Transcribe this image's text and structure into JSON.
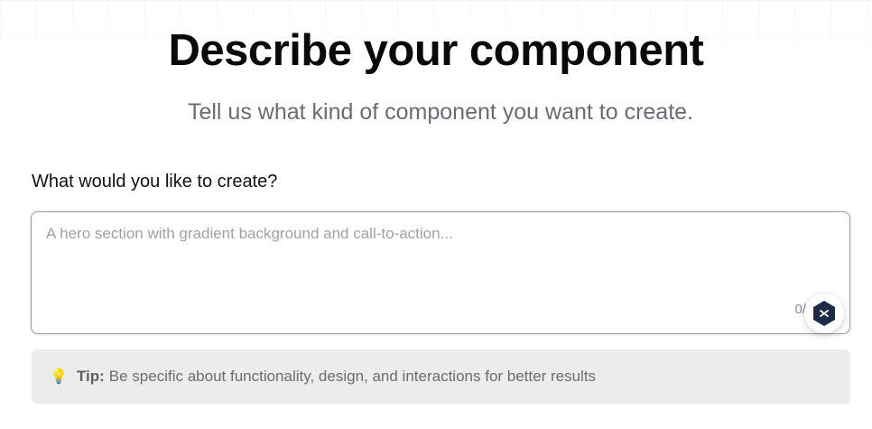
{
  "header": {
    "title": "Describe your component",
    "subtitle": "Tell us what kind of component you want to create."
  },
  "form": {
    "label": "What would you like to create?",
    "placeholder": "A hero section with gradient background and call-to-action...",
    "value": "",
    "char_count": "0/"
  },
  "tip": {
    "icon": "lightbulb-icon",
    "glyph": "💡",
    "label": "Tip:",
    "text": "Be specific about functionality, design, and interactions for better results"
  },
  "assistant_button": {
    "icon": "chat-assistant-icon"
  },
  "colors": {
    "title": "#0a0a0a",
    "subtitle": "#6b6b75",
    "tip_background": "#ececec",
    "assistant_icon": "#1c2c46"
  }
}
